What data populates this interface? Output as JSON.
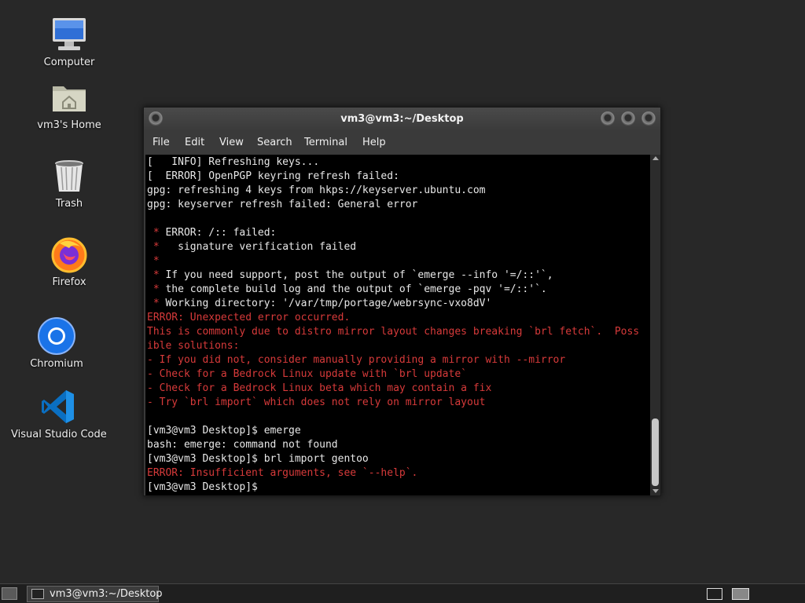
{
  "desktop_icons": [
    {
      "label": "Computer",
      "icon": "computer-icon"
    },
    {
      "label": "vm3's Home",
      "icon": "home-folder-icon"
    },
    {
      "label": "Trash",
      "icon": "trash-icon"
    },
    {
      "label": "Firefox",
      "icon": "firefox-icon"
    },
    {
      "label": "Chromium",
      "icon": "chromium-icon"
    },
    {
      "label": "Visual Studio Code",
      "icon": "vscode-icon"
    }
  ],
  "window": {
    "title": "vm3@vm3:~/Desktop",
    "menu": [
      "File",
      "Edit",
      "View",
      "Search",
      "Terminal",
      "Help"
    ]
  },
  "terminal_lines": [
    {
      "text": "[   INFO] Refreshing keys...",
      "style": "normal"
    },
    {
      "text": "[  ERROR] OpenPGP keyring refresh failed:",
      "style": "normal"
    },
    {
      "text": "gpg: refreshing 4 keys from hkps://keyserver.ubuntu.com",
      "style": "normal"
    },
    {
      "text": "gpg: keyserver refresh failed: General error",
      "style": "normal"
    },
    {
      "text": "",
      "style": "normal"
    },
    {
      "star": " * ",
      "text": "ERROR: /:: failed:",
      "style": "star"
    },
    {
      "star": " * ",
      "text": "  signature verification failed",
      "style": "star"
    },
    {
      "star": " * ",
      "text": "",
      "style": "star"
    },
    {
      "star": " * ",
      "text": "If you need support, post the output of `emerge --info '=/::'`,",
      "style": "star"
    },
    {
      "star": " * ",
      "text": "the complete build log and the output of `emerge -pqv '=/::'`.",
      "style": "star"
    },
    {
      "star": " * ",
      "text": "Working directory: '/var/tmp/portage/webrsync-vxo8dV'",
      "style": "star"
    },
    {
      "text": "ERROR: Unexpected error occurred.",
      "style": "error"
    },
    {
      "text": "This is commonly due to distro mirror layout changes breaking `brl fetch`.  Poss",
      "style": "error"
    },
    {
      "text": "ible solutions:",
      "style": "error"
    },
    {
      "text": "- If you did not, consider manually providing a mirror with --mirror",
      "style": "error"
    },
    {
      "text": "- Check for a Bedrock Linux update with `brl update`",
      "style": "error"
    },
    {
      "text": "- Check for a Bedrock Linux beta which may contain a fix",
      "style": "error"
    },
    {
      "text": "- Try `brl import` which does not rely on mirror layout",
      "style": "error"
    },
    {
      "text": "",
      "style": "normal"
    },
    {
      "text": "[vm3@vm3 Desktop]$ emerge",
      "style": "normal"
    },
    {
      "text": "bash: emerge: command not found",
      "style": "normal"
    },
    {
      "text": "[vm3@vm3 Desktop]$ brl import gentoo",
      "style": "normal"
    },
    {
      "text": "ERROR: Insufficient arguments, see `--help`.",
      "style": "error"
    },
    {
      "text": "[vm3@vm3 Desktop]$ ",
      "style": "normal"
    }
  ],
  "taskbar": {
    "task_title": "vm3@vm3:~/Desktop"
  },
  "colors": {
    "error": "#d73a3a",
    "terminal_bg": "#000000",
    "terminal_fg": "#e8e8e8"
  }
}
